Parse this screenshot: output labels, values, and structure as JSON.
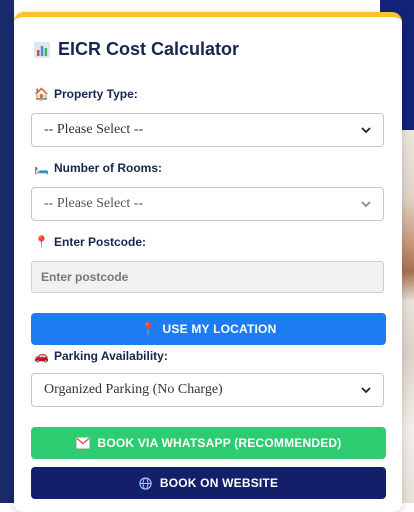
{
  "calculator": {
    "title": "EICR Cost Calculator",
    "title_icon": "bar-chart-icon",
    "property_type": {
      "label": "Property Type:",
      "icon": "house-icon",
      "selected": "-- Please Select --"
    },
    "rooms": {
      "label": "Number of Rooms:",
      "icon": "bed-icon",
      "selected": "-- Please Select --"
    },
    "postcode": {
      "label": "Enter Postcode:",
      "icon": "pin-icon",
      "placeholder": "Enter postcode",
      "value": ""
    },
    "location_button": {
      "label": "USE MY LOCATION",
      "icon": "pin-icon"
    },
    "parking": {
      "label": "Parking Availability:",
      "icon": "car-icon",
      "selected": "Organized Parking (No Charge)"
    },
    "whatsapp_button": {
      "label": "BOOK VIA WHATSAPP (RECOMMENDED)",
      "icon": "envelope-icon"
    },
    "website_button": {
      "label": "BOOK ON WEBSITE",
      "icon": "globe-icon"
    }
  },
  "colors": {
    "accent_blue": "#1e7cf2",
    "whatsapp_green": "#2ecc71",
    "navy": "#141f6a",
    "top_border": "#f4c430",
    "label_text": "#16264f"
  }
}
